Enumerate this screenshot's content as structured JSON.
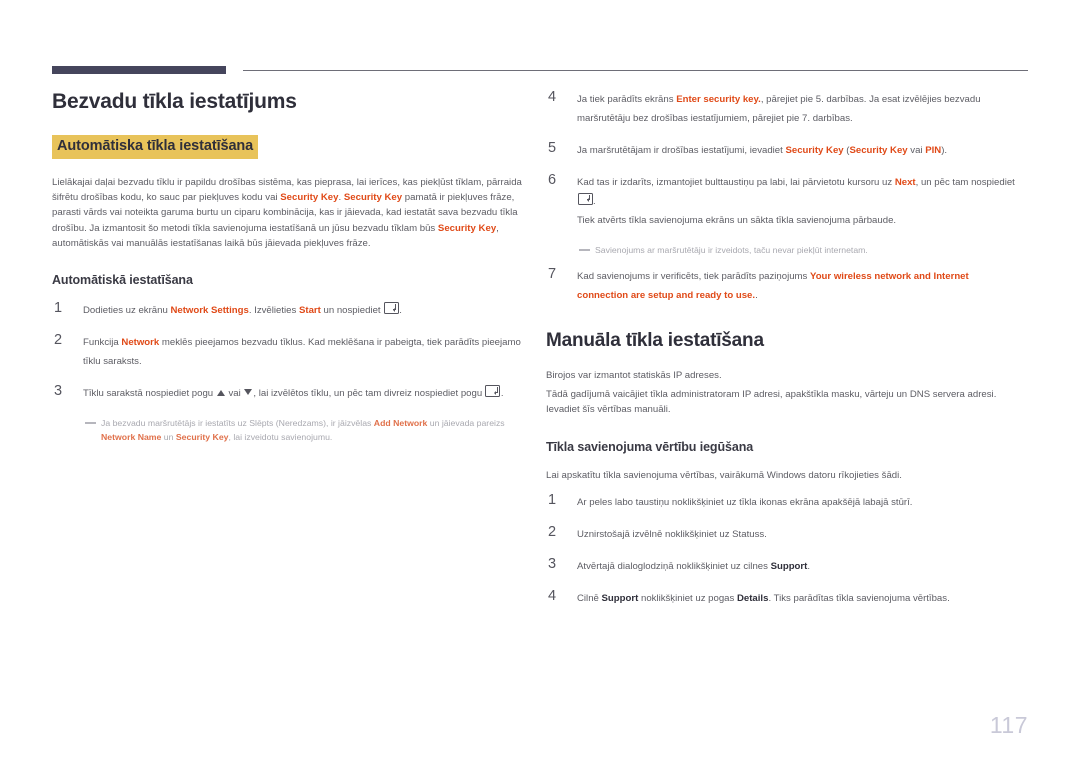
{
  "document": {
    "page_number": "117",
    "accent_color": "#e04a18",
    "highlight_color": "#e8c35a",
    "rule_color": "#45455c",
    "page_number_color": "#c9c9d8"
  },
  "left_column": {
    "chapter_title": "Bezvadu tīkla iestatījums",
    "highlight_title": "Automātiska tīkla iestatīšana",
    "intro_paragraph": {
      "part1": "Lielākajai daļai bezvadu tīklu ir papildu drošības sistēma, kas pieprasa, lai ierīces, kas piekļūst tīklam, pārraida šifrētu drošības kodu, ko sauc par piekļuves kodu vai ",
      "kw1": "Security Key",
      "part2": ". ",
      "kw2": "Security Key",
      "part3": " pamatā ir piekļuves frāze, parasti vārds vai noteikta garuma burtu un ciparu kombinācija, kas ir jāievada, kad iestatāt sava bezvadu tīkla drošību. Ja izmantosit šo metodi tīkla savienojuma iestatīšanā un jūsu bezvadu tīklam būs ",
      "kw3": "Security Key",
      "part4": ", automātiskās vai manuālās iestatīšanas laikā būs jāievada piekļuves frāze."
    },
    "sub_title": "Automātiskā iestatīšana",
    "steps": [
      {
        "num": "1",
        "p1": "Dodieties uz ekrānu ",
        "kw1": "Network Settings",
        "p2": ". Izvēlieties ",
        "kw2": "Start",
        "p3": " un nospiediet ",
        "icon": "enter-key-icon",
        "p4": "."
      },
      {
        "num": "2",
        "p1": "Funkcija ",
        "kw1": "Network",
        "p2": " meklēs pieejamos bezvadu tīklus. Kad meklēšana ir pabeigta, tiek parādīts pieejamo tīklu saraksts."
      },
      {
        "num": "3",
        "p1": "Tīklu sarakstā nospiediet pogu ",
        "icon1": "triangle-up-icon",
        "p2": " vai ",
        "icon2": "triangle-down-icon",
        "p3": ", lai izvēlētos tīklu, un pēc tam divreiz nospiediet pogu ",
        "icon3": "enter-key-icon",
        "p4": "."
      }
    ],
    "note": {
      "p1": "Ja bezvadu maršrutētājs ir iestatīts uz Slēpts (Neredzams), ir jāizvēlas ",
      "kw1": "Add Network",
      "p2": " un jāievada pareizs ",
      "kw2": "Network Name",
      "p3": " un ",
      "kw3": "Security Key",
      "p4": ", lai izveidotu savienojumu."
    }
  },
  "right_column": {
    "steps_continued": [
      {
        "num": "4",
        "p1": "Ja tiek parādīts ekrāns ",
        "kw1": "Enter security key.",
        "p2": ", pārejiet pie 5. darbības. Ja esat izvēlējies bezvadu maršrutētāju bez drošības iestatījumiem, pārejiet pie 7. darbības."
      },
      {
        "num": "5",
        "p1": "Ja maršrutētājam ir drošības iestatījumi, ievadiet ",
        "kw1": "Security Key",
        "p2": " (",
        "kw2": "Security Key",
        "p3": " vai ",
        "kw3": "PIN",
        "p4": ")."
      },
      {
        "num": "6",
        "p1": "Kad tas ir izdarīts, izmantojiet bulttaustiņu pa labi, lai pārvietotu kursoru uz ",
        "kw1": "Next",
        "p2": ", un pēc tam nospiediet ",
        "icon": "enter-key-icon",
        "p3": ".",
        "extra": "Tiek atvērts tīkla savienojuma ekrāns un sākta tīkla savienojuma pārbaude."
      },
      {
        "num": "7",
        "p1": "Kad savienojums ir verificēts, tiek parādīts paziņojums ",
        "kw1": "Your wireless network and Internet connection are setup and ready to use.",
        "p2": "."
      }
    ],
    "note": "Savienojums ar maršrutētāju ir izveidots, taču nevar piekļūt internetam.",
    "section_title": "Manuāla tīkla iestatīšana",
    "paragraph1": "Birojos var izmantot statiskās IP adreses.",
    "paragraph2": "Tādā gadījumā vaicājiet tīkla administratoram IP adresi, apakštīkla masku, vārteju un DNS servera adresi. Ievadiet šīs vērtības manuāli.",
    "sub_title": "Tīkla savienojuma vērtību iegūšana",
    "paragraph3": "Lai apskatītu tīkla savienojuma vērtības, vairākumā Windows datoru rīkojieties šādi.",
    "steps": [
      {
        "num": "1",
        "p1": "Ar peles labo taustiņu noklikšķiniet uz tīkla ikonas ekrāna apakšējā labajā stūrī."
      },
      {
        "num": "2",
        "p1": "Uznirstošajā izvēlnē noklikšķiniet uz Statuss."
      },
      {
        "num": "3",
        "p1": "Atvērtajā dialoglodziņā noklikšķiniet uz cilnes ",
        "kb1": "Support",
        "p2": "."
      },
      {
        "num": "4",
        "p1": "Cilnē ",
        "kb1": "Support",
        "p2": " noklikšķiniet uz pogas ",
        "kb2": "Details",
        "p3": ". Tiks parādītas tīkla savienojuma vērtības."
      }
    ]
  }
}
